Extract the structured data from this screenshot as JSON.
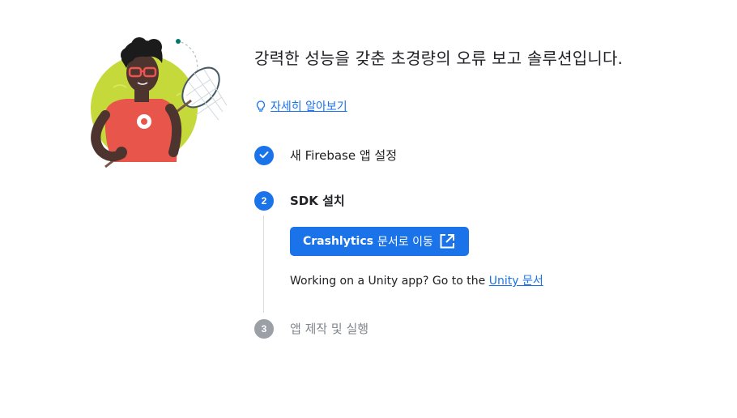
{
  "intro": {
    "headline": "강력한 성능을 갖춘 초경량의 오류 보고 솔루션입니다.",
    "learn_more_label": "자세히 알아보기",
    "learn_more_icon": "lightbulb-icon"
  },
  "steps": [
    {
      "number": "1",
      "label": "새 Firebase 앱 설정",
      "status": "completed",
      "icon": "check-icon"
    },
    {
      "number": "2",
      "label": "SDK 설치",
      "status": "active"
    },
    {
      "number": "3",
      "label": "앱 제작 및 실행",
      "status": "pending"
    }
  ],
  "sdk_step": {
    "docs_button": {
      "bold_label": "Crashlytics",
      "label": "문서로 이동",
      "icon": "open-in-new-icon"
    },
    "unity_note": {
      "prefix": "Working on a Unity app? Go to the ",
      "link_label": "Unity 문서"
    }
  },
  "colors": {
    "primary": "#1a73e8",
    "pending": "#9aa0a6",
    "text": "#202124",
    "muted_text": "#80868b",
    "illustration_green": "#c6d93a",
    "illustration_red": "#e8564b"
  }
}
